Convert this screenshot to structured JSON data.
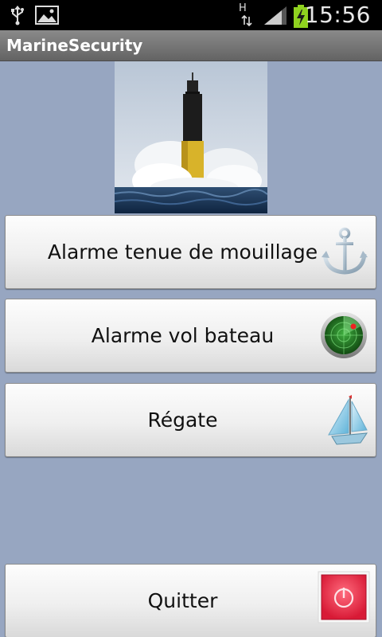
{
  "status_bar": {
    "network_label": "H",
    "time": "15:56"
  },
  "app": {
    "title": "MarineSecurity"
  },
  "buttons": {
    "anchor_alarm": "Alarme tenue de mouillage",
    "theft_alarm": "Alarme vol bateau",
    "regatta": "Régate",
    "quit": "Quitter"
  },
  "colors": {
    "background": "#97a6c1",
    "titlebar": "#7a7a7a"
  },
  "icons": {
    "anchor_alarm": "anchor-icon",
    "theft_alarm": "radar-icon",
    "regatta": "sailboat-icon",
    "quit": "power-icon"
  }
}
